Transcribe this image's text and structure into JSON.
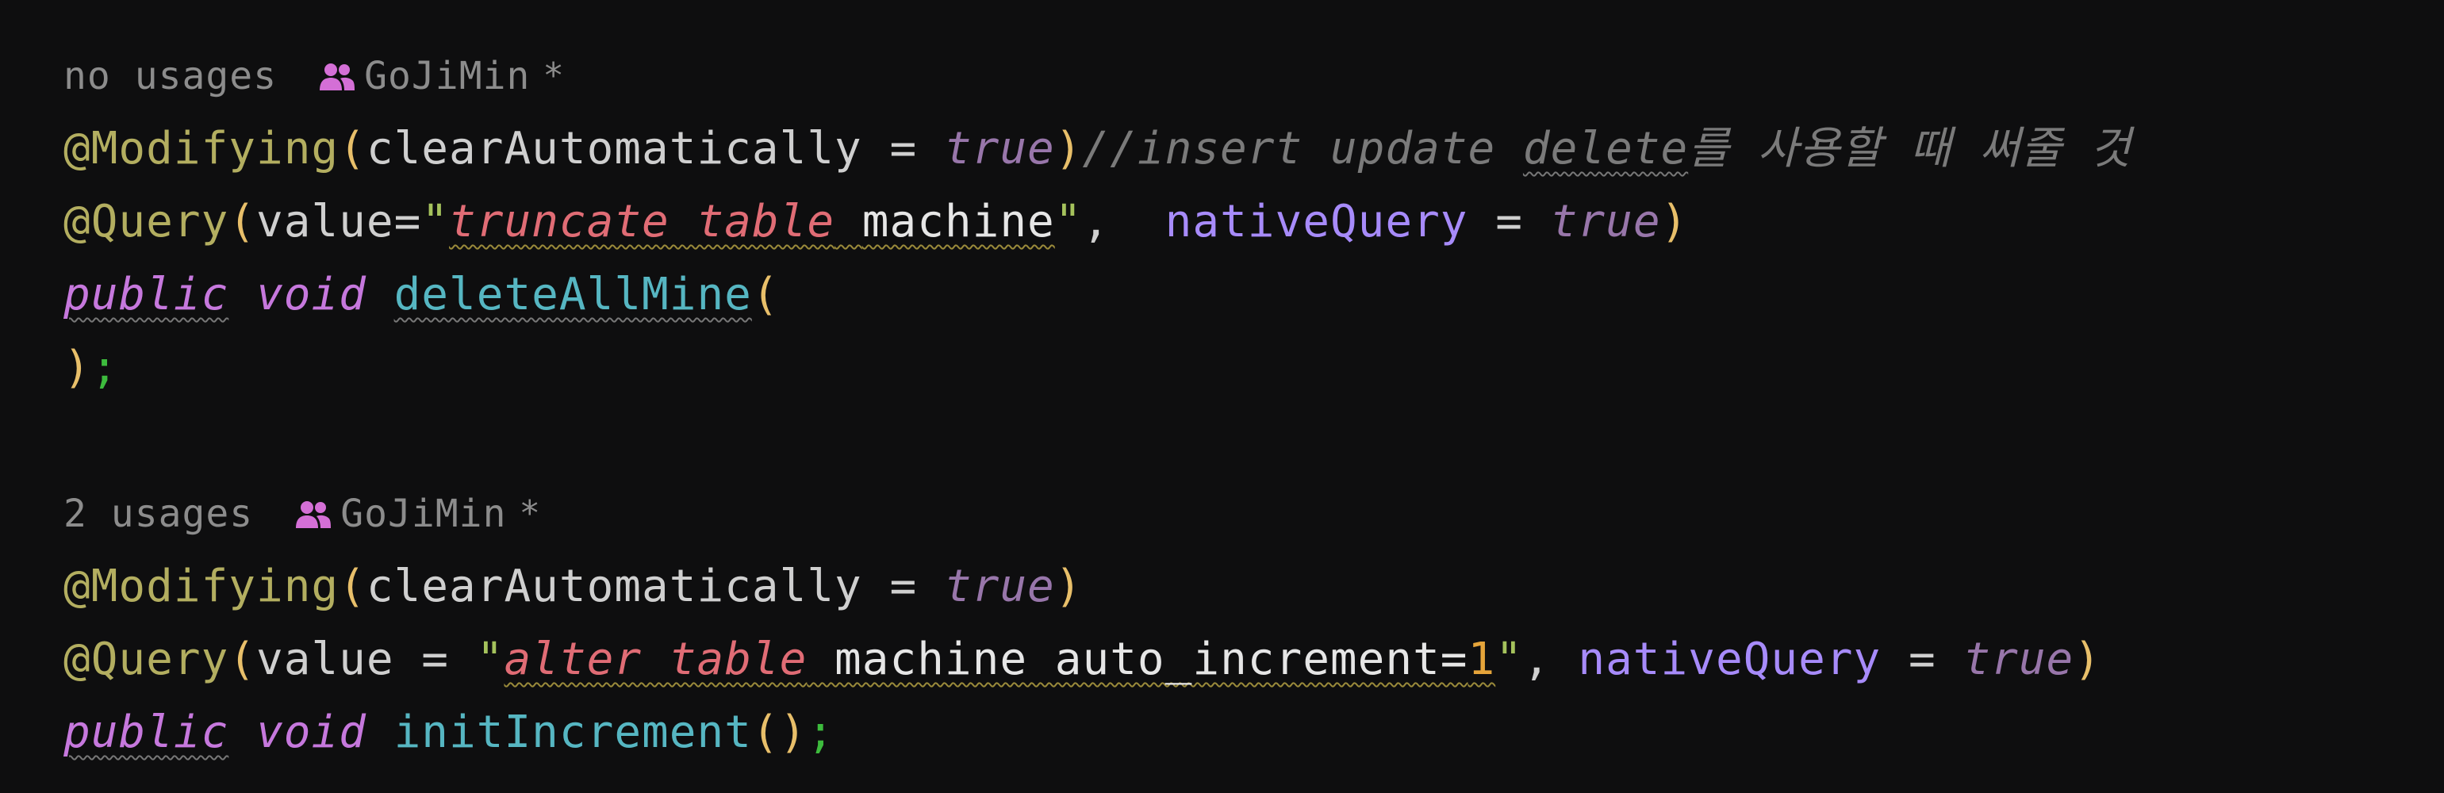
{
  "block1": {
    "hint_usages": "no usages",
    "hint_author": "GoJiMin",
    "hint_star": "*",
    "line1": {
      "annotation": "@Modifying",
      "open": "(",
      "param": "clearAutomatically",
      "eq": " = ",
      "value": "true",
      "close": ")",
      "comment": "//insert update ",
      "comment_word": "delete",
      "comment_rest": "를 사용할 때 써줄 것"
    },
    "line2": {
      "annotation": "@Query",
      "open": "(",
      "param": "value",
      "eq": "=",
      "quote_open": "\"",
      "sql_kw": "truncate table",
      "sql_space": " ",
      "sql_plain": "machine",
      "quote_close": "\"",
      "comma": ",  ",
      "named": "nativeQuery",
      "eq2": " = ",
      "value": "true",
      "close": ")"
    },
    "line3": {
      "kw1": "public",
      "space1": " ",
      "kw2": "void",
      "space2": " ",
      "method": "deleteAllMine",
      "open": "("
    },
    "line4": {
      "close": ")",
      "semi": ";"
    }
  },
  "block2": {
    "hint_usages": "2 usages",
    "hint_author": "GoJiMin",
    "hint_star": "*",
    "line1": {
      "annotation": "@Modifying",
      "open": "(",
      "param": "clearAutomatically",
      "eq": " = ",
      "value": "true",
      "close": ")"
    },
    "line2": {
      "annotation": "@Query",
      "open": "(",
      "param": "value",
      "eq": " = ",
      "quote_open": "\"",
      "sql_kw": "alter table",
      "sql_plain": " machine auto_increment=",
      "num": "1",
      "quote_close": "\"",
      "comma": ", ",
      "named": "nativeQuery",
      "eq2": " = ",
      "value": "true",
      "close": ")"
    },
    "line3": {
      "kw1": "public",
      "space1": " ",
      "kw2": "void",
      "space2": " ",
      "method": "initIncrement",
      "open": "(",
      "close": ")",
      "semi": ";"
    }
  },
  "icons": {
    "author_icon": "users-icon"
  },
  "colors": {
    "background": "#0e0e0f",
    "annotation": "#b3ae60",
    "keyword_true": "#9876aa",
    "sql_keyword": "#e06c75",
    "method": "#56b6c2",
    "named_param": "#a78bfa",
    "number": "#e5a43a",
    "comment": "#7a7a7a",
    "icon": "#d46fd6"
  }
}
